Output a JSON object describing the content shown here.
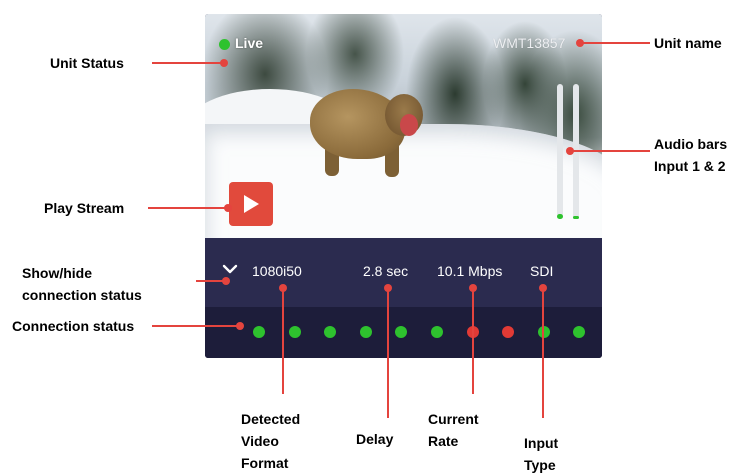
{
  "stream": {
    "status_text": "Live",
    "status_color": "#2ec22e",
    "unit_name": "WMT13857",
    "audio_levels": [
      0.04,
      0.02
    ],
    "video_format": "1080i50",
    "delay": "2.8 sec",
    "current_rate": "10.1 Mbps",
    "input_type": "SDI",
    "connection_dots": [
      "green",
      "green",
      "green",
      "green",
      "green",
      "green",
      "red",
      "red",
      "green",
      "green"
    ]
  },
  "colors": {
    "green": "#2ec22e",
    "red": "#e23a35",
    "accent": "#e14a3c"
  },
  "labels": {
    "unit_status": "Unit Status",
    "unit_name": "Unit name",
    "audio_bars_line1": "Audio bars",
    "audio_bars_line2": "Input 1 & 2",
    "play_stream": "Play Stream",
    "show_hide_line1": "Show/hide",
    "show_hide_line2": "connection status",
    "connection_status": "Connection status",
    "video_format_line1": "Detected",
    "video_format_line2": "Video",
    "video_format_line3": "Format",
    "delay": "Delay",
    "current_rate_line1": "Current",
    "current_rate_line2": "Rate",
    "input_type_line1": "Input",
    "input_type_line2": "Type"
  },
  "icons": {
    "play": "play-icon",
    "toggle": "chevron-down-icon"
  }
}
